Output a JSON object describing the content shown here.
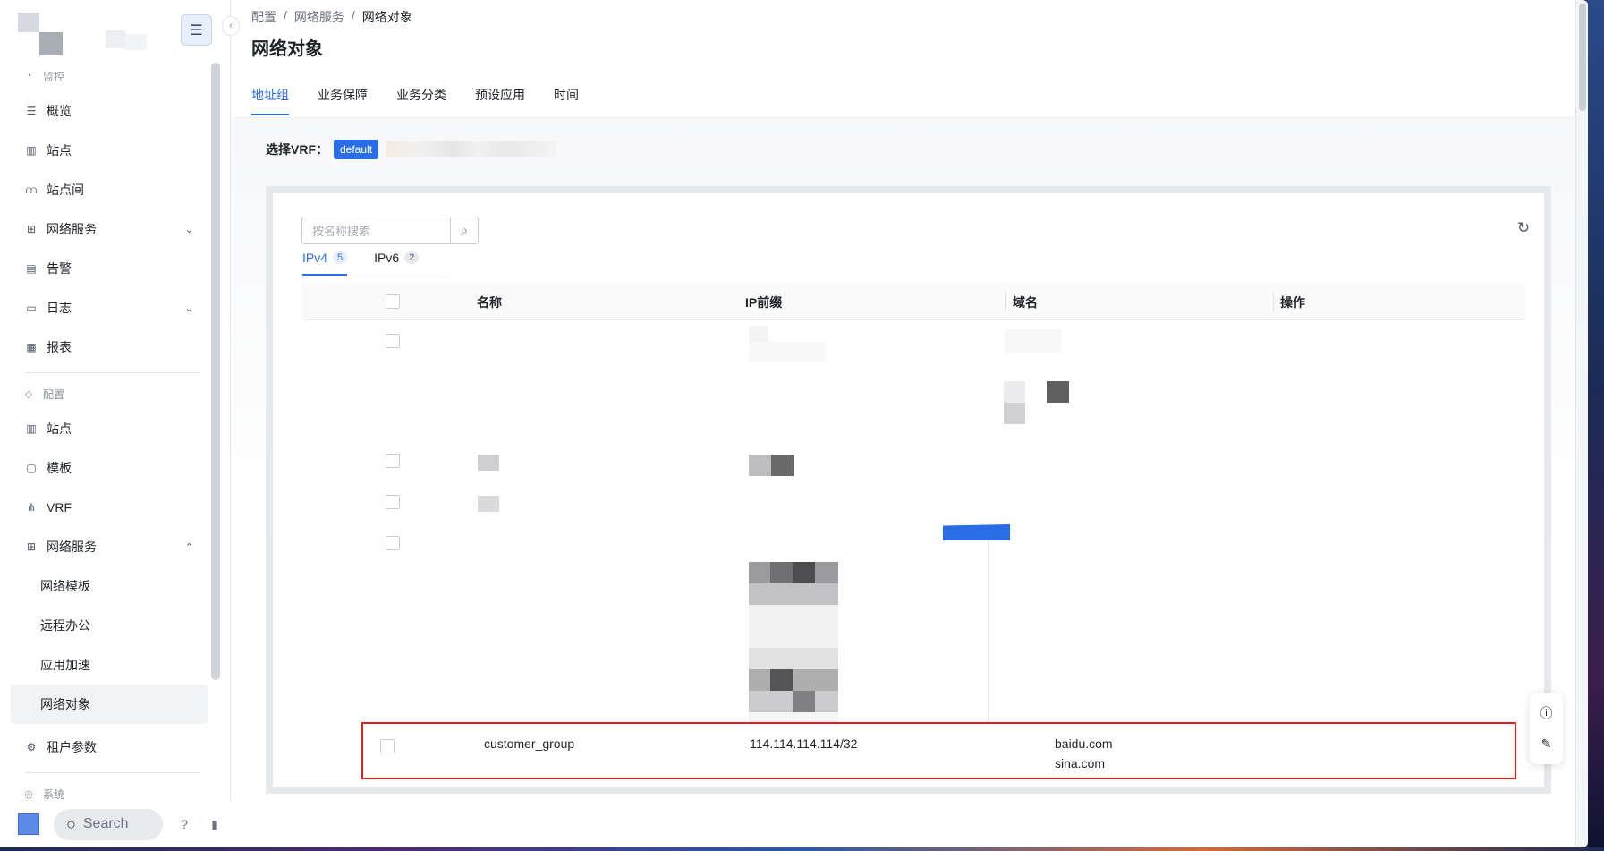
{
  "sidebar": {
    "sections": [
      {
        "title": "监控",
        "icon": "dashboard-icon",
        "items": [
          {
            "label": "概览",
            "icon": "overview-icon"
          },
          {
            "label": "站点",
            "icon": "building-icon"
          },
          {
            "label": "站点间",
            "icon": "bridge-icon"
          },
          {
            "label": "网络服务",
            "icon": "network-icon",
            "chevron": "down"
          },
          {
            "label": "告警",
            "icon": "alert-icon"
          },
          {
            "label": "日志",
            "icon": "log-icon",
            "chevron": "down"
          },
          {
            "label": "报表",
            "icon": "report-icon"
          }
        ]
      },
      {
        "title": "配置",
        "icon": "config-icon",
        "items": [
          {
            "label": "站点",
            "icon": "building-icon"
          },
          {
            "label": "模板",
            "icon": "template-icon"
          },
          {
            "label": "VRF",
            "icon": "vrf-icon"
          },
          {
            "label": "网络服务",
            "icon": "network-icon",
            "chevron": "up"
          }
        ]
      }
    ],
    "sub_items": [
      "网络模板",
      "远程办公",
      "应用加速",
      "网络对象"
    ],
    "active_sub": "网络对象",
    "tenant_label": "租户参数",
    "system_label": "系统",
    "search_label": "Search"
  },
  "breadcrumb": [
    "配置",
    "网络服务",
    "网络对象"
  ],
  "page_title": "网络对象",
  "tabs": [
    "地址组",
    "业务保障",
    "业务分类",
    "预设应用",
    "时间"
  ],
  "active_tab": "地址组",
  "vrf": {
    "label": "选择VRF：",
    "value": "default"
  },
  "search": {
    "placeholder": "按名称搜索"
  },
  "subtabs": [
    {
      "label": "IPv4",
      "count": "5",
      "active": true
    },
    {
      "label": "IPv6",
      "count": "2",
      "active": false
    }
  ],
  "table": {
    "columns": [
      "名称",
      "IP前缀",
      "域名",
      "操作"
    ],
    "highlighted_row": {
      "name": "customer_group",
      "ip_prefix": "114.114.114.114/32",
      "domains": [
        "baidu.com",
        "sina.com"
      ]
    }
  },
  "colors": {
    "accent": "#2b6de5",
    "highlight_border": "#e0201e"
  }
}
